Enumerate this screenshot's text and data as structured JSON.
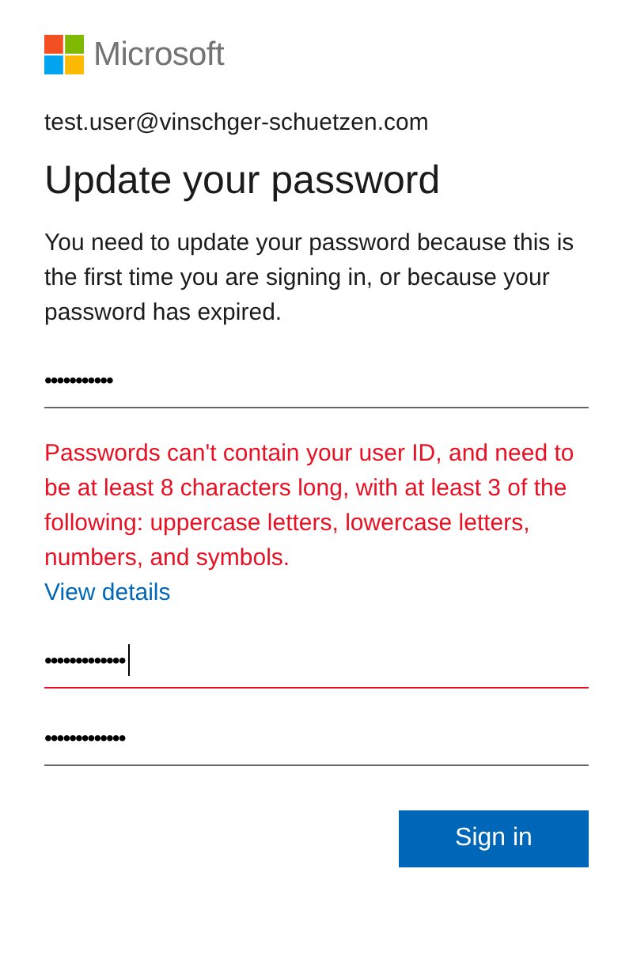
{
  "logo": {
    "text": "Microsoft"
  },
  "account": "test.user@vinschger-schuetzen.com",
  "title": "Update your password",
  "description": "You need to update your password because this is the first time you are signing in, or because your password has expired.",
  "fields": [
    {
      "value": "•••••••••••",
      "error": false,
      "focused": false
    },
    {
      "value": "•••••••••••••",
      "error": true,
      "focused": true
    },
    {
      "value": "•••••••••••••",
      "error": false,
      "focused": false
    }
  ],
  "error_message": "Passwords can't contain your user ID, and need to be at least 8 characters long, with at least 3 of the following: uppercase letters, lowercase letters, numbers, and symbols.",
  "error_link": "View details",
  "button": "Sign in"
}
